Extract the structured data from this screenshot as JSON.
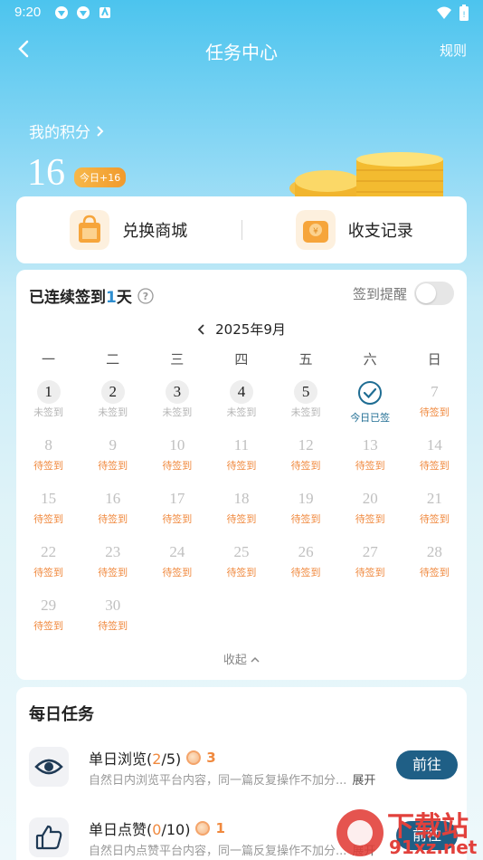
{
  "status_bar": {
    "time": "9:20",
    "icons": [
      "app-notification-icon",
      "app-notification-icon",
      "app-notification-icon"
    ],
    "right_icons": [
      "wifi-icon",
      "battery-icon"
    ]
  },
  "nav": {
    "back_icon": "back-arrow-icon",
    "title": "任务中心",
    "rules": "规则"
  },
  "points": {
    "label": "我的积分",
    "value": "16",
    "today_badge": "今日+16"
  },
  "quick_links": [
    {
      "label": "兑换商城",
      "icon": "shopping-bag-icon"
    },
    {
      "label": "收支记录",
      "icon": "wallet-icon"
    }
  ],
  "checkin": {
    "prefix": "已连续签到",
    "days": "1",
    "suffix": "天",
    "reminder_label": "签到提醒",
    "reminder_on": false,
    "month": "2025年9月",
    "weekdays": [
      "一",
      "二",
      "三",
      "四",
      "五",
      "六",
      "日"
    ],
    "collapse_label": "收起",
    "weeks": [
      [
        {
          "d": "1",
          "s": "未签到",
          "t": "past"
        },
        {
          "d": "2",
          "s": "未签到",
          "t": "past"
        },
        {
          "d": "3",
          "s": "未签到",
          "t": "past"
        },
        {
          "d": "4",
          "s": "未签到",
          "t": "past"
        },
        {
          "d": "5",
          "s": "未签到",
          "t": "past"
        },
        {
          "d": "",
          "s": "今日已签",
          "t": "done"
        },
        {
          "d": "7",
          "s": "待签到",
          "t": "future"
        }
      ],
      [
        {
          "d": "8",
          "s": "待签到",
          "t": "future"
        },
        {
          "d": "9",
          "s": "待签到",
          "t": "future"
        },
        {
          "d": "10",
          "s": "待签到",
          "t": "future"
        },
        {
          "d": "11",
          "s": "待签到",
          "t": "future"
        },
        {
          "d": "12",
          "s": "待签到",
          "t": "future"
        },
        {
          "d": "13",
          "s": "待签到",
          "t": "future"
        },
        {
          "d": "14",
          "s": "待签到",
          "t": "future"
        }
      ],
      [
        {
          "d": "15",
          "s": "待签到",
          "t": "future"
        },
        {
          "d": "16",
          "s": "待签到",
          "t": "future"
        },
        {
          "d": "17",
          "s": "待签到",
          "t": "future"
        },
        {
          "d": "18",
          "s": "待签到",
          "t": "future"
        },
        {
          "d": "19",
          "s": "待签到",
          "t": "future"
        },
        {
          "d": "20",
          "s": "待签到",
          "t": "future"
        },
        {
          "d": "21",
          "s": "待签到",
          "t": "future"
        }
      ],
      [
        {
          "d": "22",
          "s": "待签到",
          "t": "future"
        },
        {
          "d": "23",
          "s": "待签到",
          "t": "future"
        },
        {
          "d": "24",
          "s": "待签到",
          "t": "future"
        },
        {
          "d": "25",
          "s": "待签到",
          "t": "future"
        },
        {
          "d": "26",
          "s": "待签到",
          "t": "future"
        },
        {
          "d": "27",
          "s": "待签到",
          "t": "future"
        },
        {
          "d": "28",
          "s": "待签到",
          "t": "future"
        }
      ],
      [
        {
          "d": "29",
          "s": "待签到",
          "t": "future"
        },
        {
          "d": "30",
          "s": "待签到",
          "t": "future"
        }
      ]
    ]
  },
  "daily_tasks": {
    "title": "每日任务",
    "items": [
      {
        "icon": "eye-icon",
        "name": "单日浏览(",
        "current": "2",
        "rest": "/5)",
        "reward": "3",
        "desc": "自然日内浏览平台内容，同一篇反复操作不加分...",
        "expand": "展开",
        "button": "前往"
      },
      {
        "icon": "thumbs-up-icon",
        "name": "单日点赞(",
        "current": "0",
        "rest": "/10)",
        "reward": "1",
        "desc": "自然日内点赞平台内容，同一篇反复操作不加分...",
        "expand": "展开",
        "button": "前往"
      }
    ]
  },
  "watermark": {
    "text_top": "下载站",
    "text_bottom": "91xz.net"
  },
  "colors": {
    "accent": "#1f5f86",
    "orange": "#f0893e",
    "blue_num": "#2f8ecf"
  }
}
